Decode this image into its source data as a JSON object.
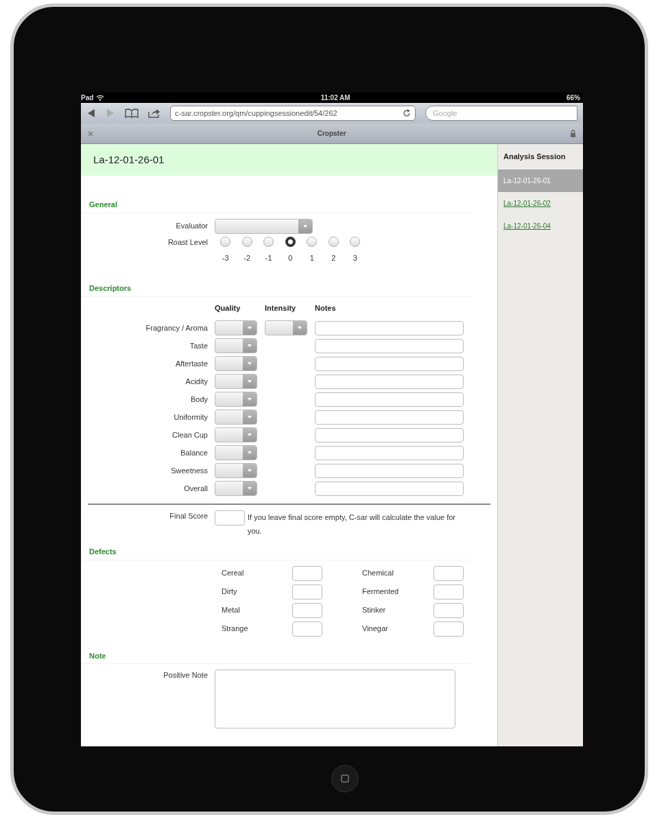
{
  "status_bar": {
    "carrier": "Pad",
    "time": "11:02 AM",
    "battery": "66%"
  },
  "browser": {
    "url": "c-sar.cropster.org/qm/cuppingsessionedit/54/262",
    "search_placeholder": "Google",
    "tab_title": "Cropster"
  },
  "page": {
    "title": "La-12-01-26-01",
    "general": {
      "heading": "General",
      "evaluator_label": "Evaluator",
      "roast_label": "Roast Level",
      "roast_options": [
        {
          "label": "-3",
          "selected": false
        },
        {
          "label": "-2",
          "selected": false
        },
        {
          "label": "-1",
          "selected": false
        },
        {
          "label": "0",
          "selected": true
        },
        {
          "label": "1",
          "selected": false
        },
        {
          "label": "2",
          "selected": false
        },
        {
          "label": "3",
          "selected": false
        }
      ]
    },
    "descriptors": {
      "heading": "Descriptors",
      "columns": [
        "Quality",
        "Intensity",
        "Notes"
      ],
      "rows": [
        {
          "label": "Fragrancy / Aroma",
          "intensity": true
        },
        {
          "label": "Taste",
          "intensity": false
        },
        {
          "label": "Aftertaste",
          "intensity": false
        },
        {
          "label": "Acidity",
          "intensity": false
        },
        {
          "label": "Body",
          "intensity": false
        },
        {
          "label": "Uniformity",
          "intensity": false
        },
        {
          "label": "Clean Cup",
          "intensity": false
        },
        {
          "label": "Balance",
          "intensity": false
        },
        {
          "label": "Sweetness",
          "intensity": false
        },
        {
          "label": "Overall",
          "intensity": false
        }
      ],
      "final_score_label": "Final Score",
      "final_score_hint": "If you leave final score empty, C-sar will calculate the value for you."
    },
    "defects": {
      "heading": "Defects",
      "items": [
        "Cereal",
        "Chemical",
        "Dirty",
        "Fermented",
        "Metal",
        "Stinker",
        "Strange",
        "Vinegar"
      ]
    },
    "note": {
      "heading": "Note",
      "positive_label": "Positive Note"
    }
  },
  "sidebar": {
    "title": "Analysis Session",
    "items": [
      {
        "label": "La-12-01-26-01",
        "selected": true
      },
      {
        "label": "La-12-01-26-02",
        "selected": false
      },
      {
        "label": "La-12-01-26-04",
        "selected": false
      }
    ]
  }
}
